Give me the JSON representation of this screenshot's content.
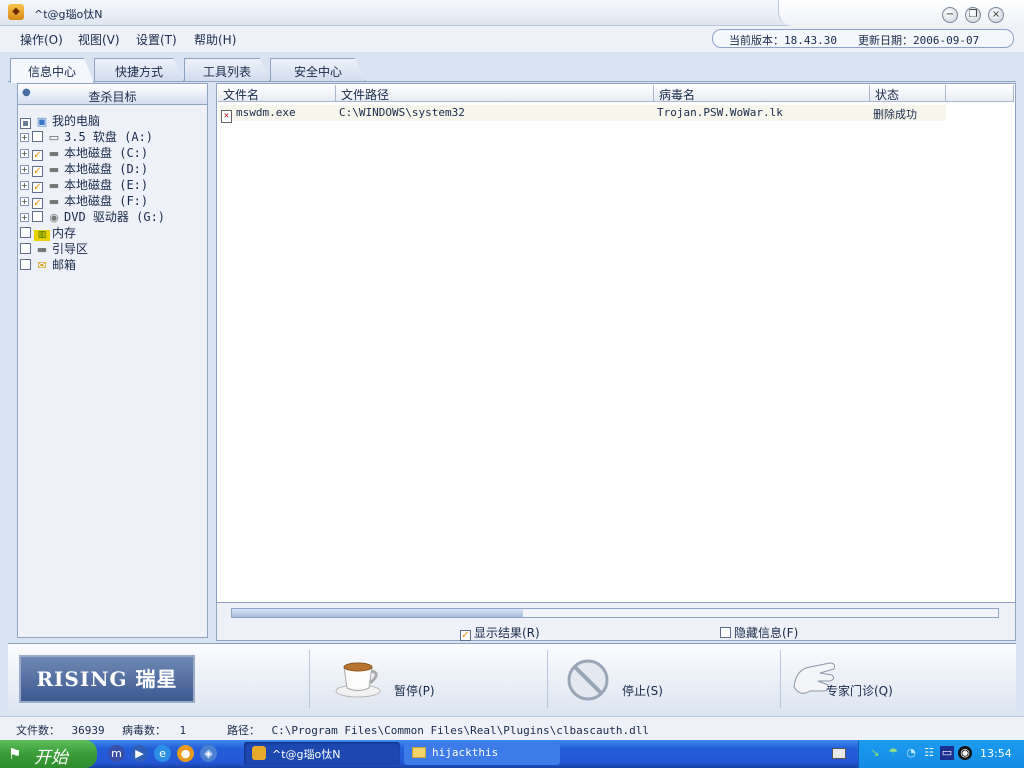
{
  "window": {
    "title": "^t@g瑙o忲N",
    "controls": [
      "−",
      "❐",
      "×"
    ]
  },
  "menu": {
    "items": [
      "操作(O)",
      "视图(V)",
      "设置(T)",
      "帮助(H)"
    ],
    "version_label": "当前版本：",
    "version": "18.43.30",
    "update_label": "更新日期：",
    "update_date": "2006-09-07"
  },
  "tabs": [
    "信息中心",
    "快捷方式",
    "工具列表",
    "安全中心"
  ],
  "left": {
    "header": "查杀目标",
    "tree": [
      {
        "label": "我的电脑",
        "checked": "mixed"
      },
      {
        "label": "3.5 软盘 (A:)",
        "checked": false
      },
      {
        "label": "本地磁盘 (C:)",
        "checked": true
      },
      {
        "label": "本地磁盘 (D:)",
        "checked": true
      },
      {
        "label": "本地磁盘 (E:)",
        "checked": true
      },
      {
        "label": "本地磁盘 (F:)",
        "checked": true
      },
      {
        "label": "DVD 驱动器 (G:)",
        "checked": false
      },
      {
        "label": "内存",
        "checked": false
      },
      {
        "label": "引导区",
        "checked": false
      },
      {
        "label": "邮箱",
        "checked": false
      }
    ]
  },
  "results": {
    "columns": [
      "文件名",
      "文件路径",
      "病毒名",
      "状态"
    ],
    "rows": [
      {
        "file": "mswdm.exe",
        "path": "C:\\WINDOWS\\system32",
        "virus": "Trojan.PSW.WoWar.lk",
        "status": "删除成功"
      }
    ],
    "progress": 0.38
  },
  "options": {
    "show_results": "显示结果(R)",
    "show_results_checked": true,
    "hide_info": "隐藏信息(F)",
    "hide_info_checked": false
  },
  "actions": {
    "logo": "RISING 瑞星",
    "pause": "暂停(P)",
    "stop": "停止(S)",
    "expert": "专家门诊(Q)"
  },
  "status": {
    "files_label": "文件数：",
    "files": "36939",
    "virus_label": "病毒数：",
    "viruses": "1",
    "path_label": "路径：",
    "path": "C:\\Program Files\\Common Files\\Real\\Plugins\\clbascauth.dll"
  },
  "taskbar": {
    "start": "开始",
    "tasks": [
      "^t@g瑙o忲N",
      "hijackthis"
    ],
    "clock": "13:54"
  },
  "colors": {
    "accent": "#245ed8",
    "panel_border": "#8fa2c4",
    "check": "#e08a00"
  }
}
